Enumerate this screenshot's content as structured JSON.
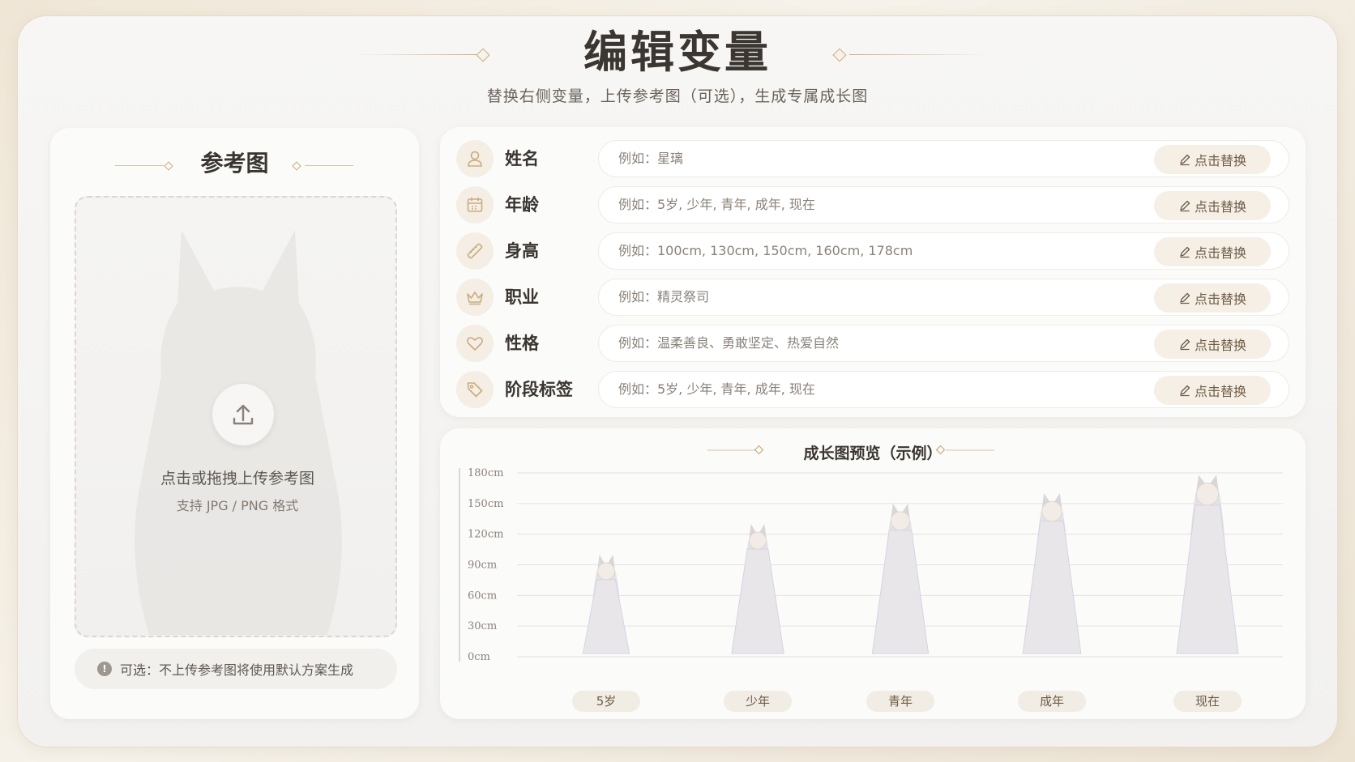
{
  "page": {
    "title": "编辑变量",
    "subtitle": "替换右侧变量，上传参考图（可选），生成专属成长图"
  },
  "reference": {
    "title": "参考图",
    "upload_text": "点击或拖拽上传参考图",
    "upload_hint": "支持 JPG / PNG 格式",
    "optional_note": "可选：不上传参考图将使用默认方案生成",
    "info_glyph": "!"
  },
  "variables": [
    {
      "label": "姓名",
      "icon": "user-icon",
      "placeholder": "例如：星璃",
      "button": "点击替换"
    },
    {
      "label": "年龄",
      "icon": "calendar-icon",
      "placeholder": "例如：5岁, 少年, 青年, 成年, 现在",
      "button": "点击替换"
    },
    {
      "label": "身高",
      "icon": "ruler-icon",
      "placeholder": "例如：100cm, 130cm, 150cm, 160cm, 178cm",
      "button": "点击替换"
    },
    {
      "label": "职业",
      "icon": "crown-icon",
      "placeholder": "例如：精灵祭司",
      "button": "点击替换"
    },
    {
      "label": "性格",
      "icon": "heart-icon",
      "placeholder": "例如：温柔善良、勇敢坚定、热爱自然",
      "button": "点击替换"
    },
    {
      "label": "阶段标签",
      "icon": "tag-icon",
      "placeholder": "例如：5岁, 少年, 青年, 成年, 现在",
      "button": "点击替换"
    }
  ],
  "preview": {
    "title": "成长图预览（示例）"
  },
  "chart_data": {
    "type": "bar",
    "title": "成长图预览（示例）",
    "categories": [
      "5岁",
      "少年",
      "青年",
      "成年",
      "现在"
    ],
    "values": [
      100,
      130,
      150,
      160,
      178
    ],
    "y_ticks": [
      "0cm",
      "30cm",
      "60cm",
      "90cm",
      "120cm",
      "150cm",
      "180cm"
    ],
    "ylim": [
      0,
      180
    ],
    "grid": true
  },
  "colors": {
    "accent": "#c9ab7d",
    "figure": "#e9e6ea",
    "figure_shade": "#d5d3e3"
  }
}
